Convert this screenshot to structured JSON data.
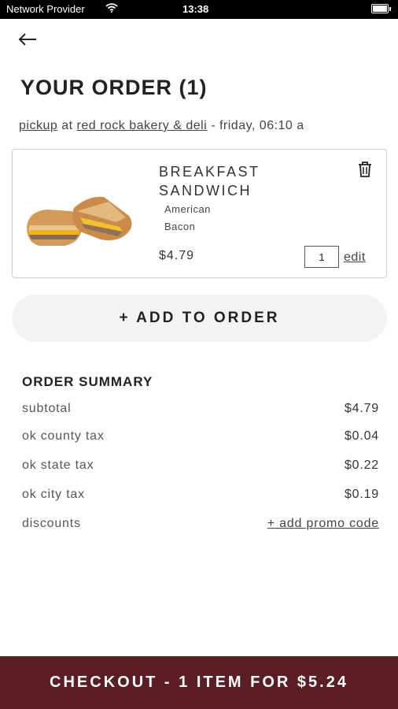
{
  "status_bar": {
    "carrier": "Network Provider",
    "time": "13:38"
  },
  "header": {
    "title": "YOUR ORDER (1)"
  },
  "pickup": {
    "pickup_word": "pickup",
    "at_word": "at",
    "location": "red rock bakery & deli",
    "schedule": "- friday, 06:10 a"
  },
  "item": {
    "name": "BREAKFAST SANDWICH",
    "modifiers": [
      "American",
      "Bacon"
    ],
    "price": "$4.79",
    "quantity": "1",
    "edit_label": "edit"
  },
  "add_to_order_label": "+ ADD TO ORDER",
  "summary": {
    "title": "ORDER SUMMARY",
    "rows": [
      {
        "label": "subtotal",
        "value": "$4.79"
      },
      {
        "label": "ok county tax",
        "value": "$0.04"
      },
      {
        "label": "ok state tax",
        "value": "$0.22"
      },
      {
        "label": "ok city tax",
        "value": "$0.19"
      }
    ],
    "discounts_label": "discounts",
    "promo_label": "+ add promo code"
  },
  "checkout_label": "CHECKOUT - 1 ITEM FOR $5.24",
  "colors": {
    "checkout_bg": "#5b1e24",
    "add_button_bg": "#f3f3f6"
  }
}
